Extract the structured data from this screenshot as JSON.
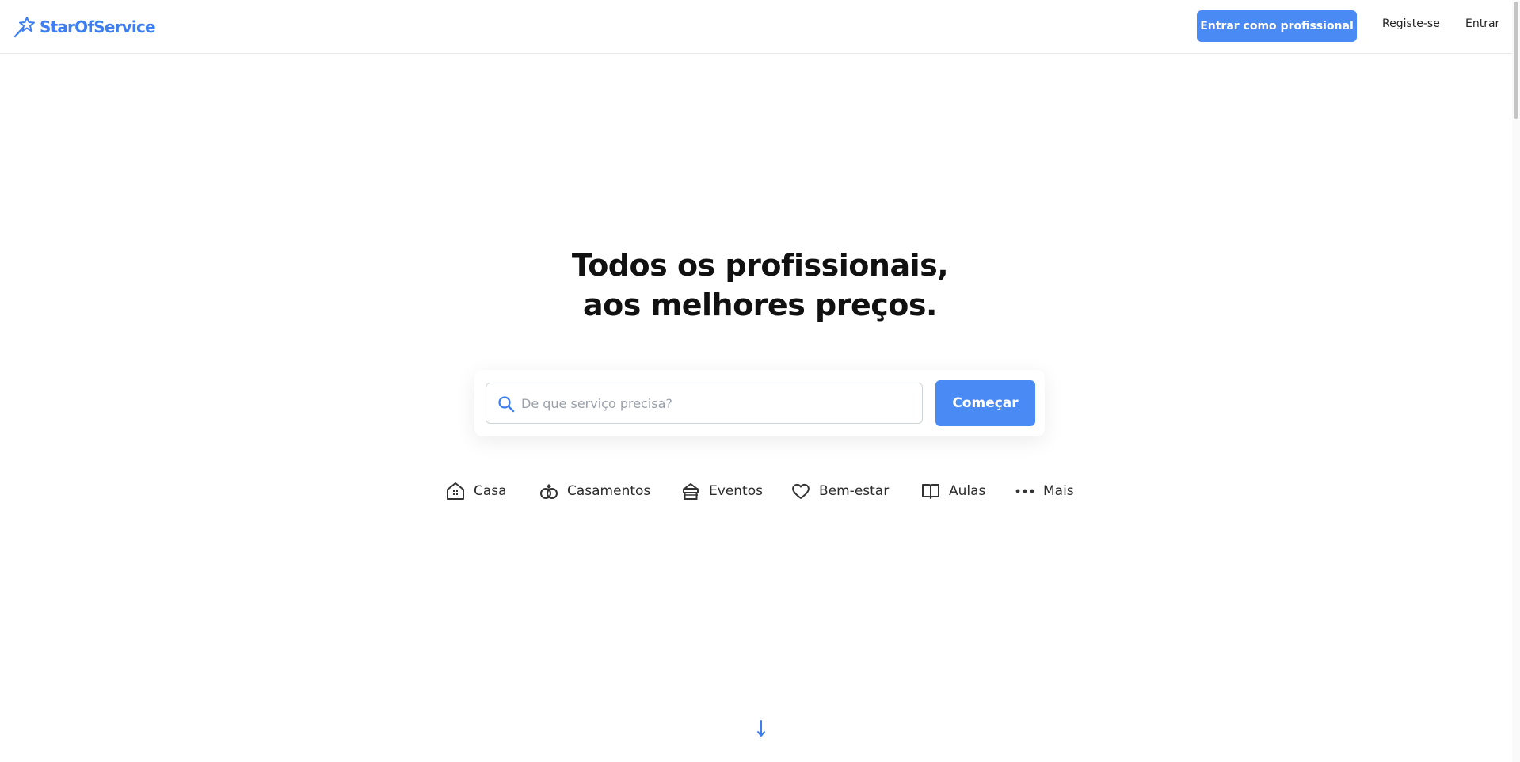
{
  "brand": {
    "name": "StarOfService",
    "accent": "#4a8af4",
    "logo_icon": "star-wand-icon"
  },
  "header": {
    "pro_button": "Entrar como profissional",
    "register": "Registe-se",
    "login": "Entrar"
  },
  "hero": {
    "title_line1": "Todos os profissionais,",
    "title_line2": "aos melhores preços."
  },
  "search": {
    "placeholder": "De que serviço precisa?",
    "value": "",
    "icon": "search-icon",
    "button": "Começar"
  },
  "categories": [
    {
      "label": "Casa",
      "icon": "house-icon"
    },
    {
      "label": "Casamentos",
      "icon": "rings-icon"
    },
    {
      "label": "Eventos",
      "icon": "gift-icon"
    },
    {
      "label": "Bem-estar",
      "icon": "heart-icon"
    },
    {
      "label": "Aulas",
      "icon": "book-icon"
    },
    {
      "label": "Mais",
      "icon": "more-dots-icon"
    }
  ],
  "scroll_hint": {
    "icon": "arrow-down-icon"
  }
}
